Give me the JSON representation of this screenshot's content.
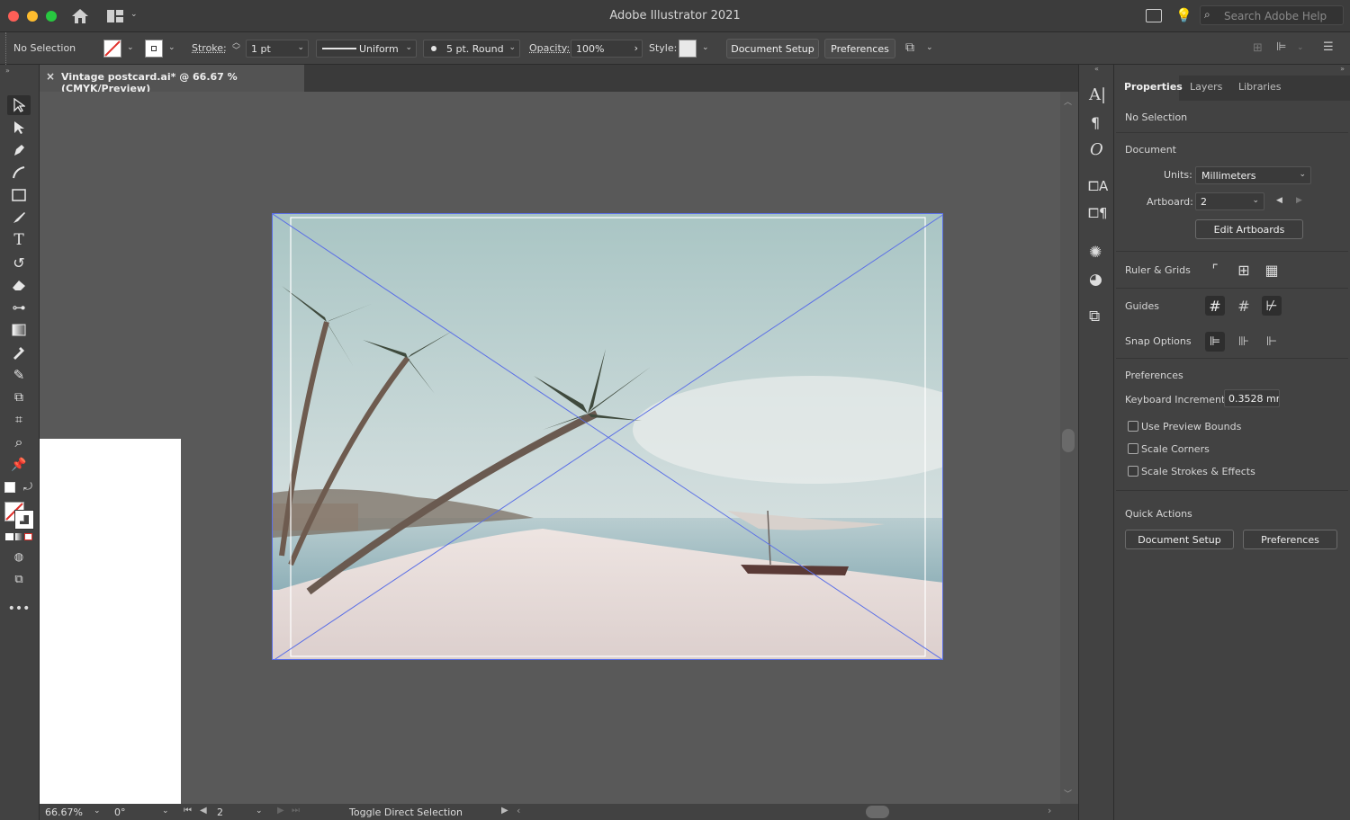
{
  "app": {
    "title": "Adobe Illustrator 2021",
    "search_placeholder": "Search Adobe Help"
  },
  "control_bar": {
    "selection": "No Selection",
    "stroke_label": "Stroke:",
    "stroke_weight": "1 pt",
    "profile": "Uniform",
    "brush": "5 pt. Round",
    "opacity_label": "Opacity:",
    "opacity_value": "100%",
    "style_label": "Style:",
    "document_setup": "Document Setup",
    "preferences": "Preferences"
  },
  "document_tab": {
    "name": "Vintage postcard.ai* @ 66.67 % (CMYK/Preview)"
  },
  "status_bar": {
    "zoom": "66.67%",
    "rotation": "0°",
    "artboard": "2",
    "status": "Toggle Direct Selection"
  },
  "panel": {
    "tabs": [
      "Properties",
      "Layers",
      "Libraries"
    ],
    "selection": "No Selection",
    "document_heading": "Document",
    "units_label": "Units:",
    "units_value": "Millimeters",
    "artboard_label": "Artboard:",
    "artboard_value": "2",
    "edit_artboards": "Edit Artboards",
    "ruler_grids": "Ruler & Grids",
    "guides": "Guides",
    "snap_options": "Snap Options",
    "preferences_heading": "Preferences",
    "keyboard_increment_label": "Keyboard Increment:",
    "keyboard_increment_value": "0.3528 mr",
    "checkboxes": [
      "Use Preview Bounds",
      "Scale Corners",
      "Scale Strokes & Effects"
    ],
    "quick_actions": "Quick Actions",
    "document_setup": "Document Setup",
    "preferences": "Preferences"
  },
  "colors": {
    "accent_guides": "#5b6fe6",
    "panel_bg": "#424242",
    "canvas_bg": "#595959"
  }
}
